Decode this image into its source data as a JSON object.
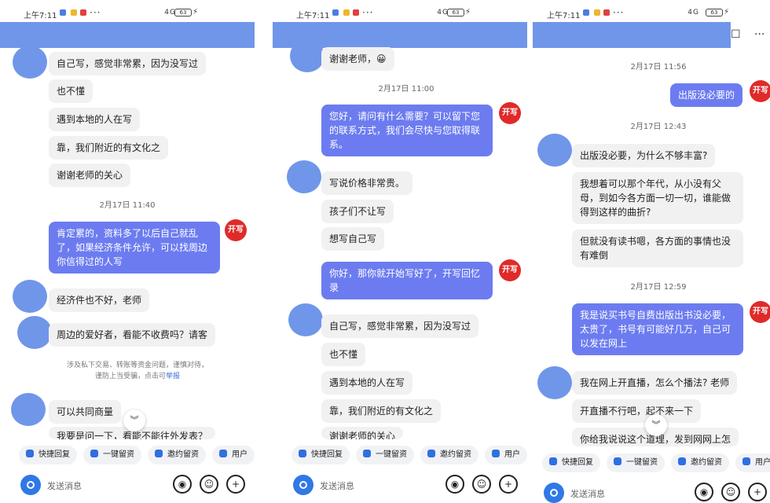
{
  "status": {
    "time": "上午7:11",
    "dots": "···",
    "signal": "4G",
    "battery": "63"
  },
  "panel1": {
    "messages": [
      "自己写，感觉非常累，因为没写过",
      "也不懂",
      "遇到本地的人在写",
      "靠，我们附近的有文化之",
      "谢谢老师的关心"
    ],
    "timestamp1": "2月17日 11:40",
    "reply1": "肯定累的，资料多了以后自己就乱了，如果经济条件允许，可以找周边你信得过的人写",
    "messages2": [
      "经济件也不好，老师",
      "周边的爱好者，看能不收费吗？请客"
    ],
    "notice_line1": "涉及私下交易、转账等资金问题，谨慎对待，",
    "notice_line2": "谨防上当受骗，点击可",
    "notice_link": "举报",
    "messages3": [
      "可以共同商量",
      "我要是问一下，看能不能往外发表？"
    ]
  },
  "panel2": {
    "messages0": [
      "谢谢老师，😀"
    ],
    "timestamp1": "2月17日 11:00",
    "reply1": "您好，请问有什么需要？可以留下您的联系方式，我们会尽快与您取得联系。",
    "messages1": [
      "写说价格非常贵。",
      "孩子们不让写",
      "想写自己写"
    ],
    "reply2": "你好，那你就开始写好了，开写回忆录",
    "messages2": [
      "自己写，感觉非常累，因为没写过",
      "也不懂",
      "遇到本地的人在写",
      "靠，我们附近的有文化之",
      "谢谢老师的关心"
    ]
  },
  "panel3": {
    "timestamp0": "2月17日 11:56",
    "reply0": "出版没必要的",
    "timestamp1": "2月17日 12:43",
    "messages1": [
      "出版没必要，为什么不够丰富?",
      "我想着可以那个年代，从小没有父母，到如今各方面一切一切，谁能做得到这样的曲折?",
      "但就没有读书嗯，各方面的事情也没有难倒"
    ],
    "timestamp2": "2月17日 12:59",
    "reply2": "我是说买书号自费出版出书没必要，太贵了，书号有可能好几万，自己可以发在网上",
    "messages2": [
      "我在网上开直播，怎么个播法? 老师",
      "开直播不行吧，起不来一下",
      "你给我说说这个道理，发到网网上怎"
    ]
  },
  "logo_text": "开写",
  "chevron": "︾",
  "chips": [
    "快捷回复",
    "一键留资",
    "邀约留资",
    "用户"
  ],
  "input": {
    "placeholder": "发送消息",
    "voice": "◉",
    "emoji": "☺",
    "plus": "+"
  },
  "top_icons": {
    "bookmark": "☐",
    "more": "···"
  },
  "colors": {
    "accent_bar": "#7096e9",
    "out_bubble": "#6c7cf0",
    "in_bubble": "#f1f1f1",
    "logo": "#e02a2a"
  }
}
